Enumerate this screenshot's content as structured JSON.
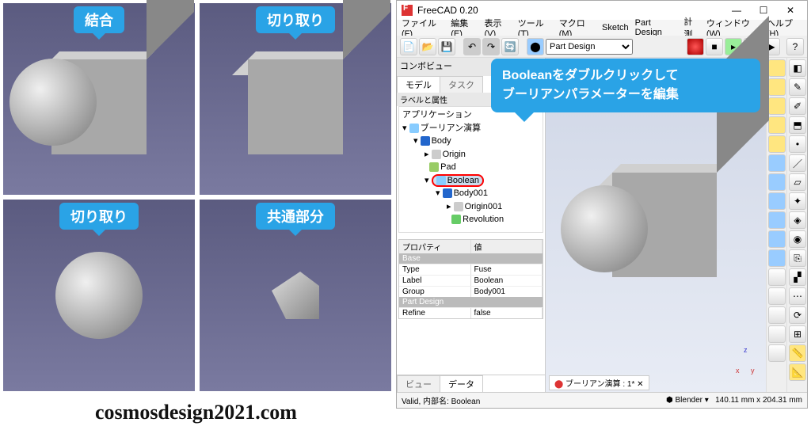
{
  "examples": {
    "labels": [
      "結合",
      "切り取り",
      "切り取り",
      "共通部分"
    ]
  },
  "app": {
    "title": "FreeCAD 0.20",
    "menus": [
      "ファイル(F)",
      "編集(E)",
      "表示(V)",
      "ツール(T)",
      "マクロ(M)",
      "Sketch",
      "Part Design",
      "計測",
      "ウィンドウ(W)",
      "ヘルプ(H)"
    ],
    "workbench": "Part Design",
    "combo_title": "コンボビュー",
    "combo_tabs": [
      "モデル",
      "タスク"
    ],
    "label_attr": "ラベルと属性",
    "tree": {
      "app": "アプリケーション",
      "doc": "ブーリアン演算",
      "body": "Body",
      "origin": "Origin",
      "pad": "Pad",
      "boolean": "Boolean",
      "body001": "Body001",
      "origin001": "Origin001",
      "revolution": "Revolution"
    },
    "props": {
      "header": [
        "プロパティ",
        "値"
      ],
      "sections": {
        "base": "Base",
        "partdesign": "Part Design"
      },
      "rows": [
        {
          "k": "Type",
          "v": "Fuse"
        },
        {
          "k": "Label",
          "v": "Boolean"
        },
        {
          "k": "Group",
          "v": "Body001"
        },
        {
          "k": "Refine",
          "v": "false"
        }
      ]
    },
    "lower_tabs": [
      "ビュー",
      "データ"
    ],
    "doc_tab": "ブーリアン演算 : 1*",
    "status": {
      "left": "Valid, 内部名: Boolean",
      "nav": "Blender",
      "dims": "140.11 mm x 204.31 mm"
    }
  },
  "callout": {
    "line1": "Booleanをダブルクリックして",
    "line2": "ブーリアンパラメーターを編集"
  },
  "watermark": "cosmosdesign2021.com",
  "icons": {
    "doc": "doc-icon",
    "open": "open-icon",
    "save": "save-icon",
    "record": "record-icon",
    "globe": "globe-icon",
    "refresh": "refresh-icon"
  }
}
